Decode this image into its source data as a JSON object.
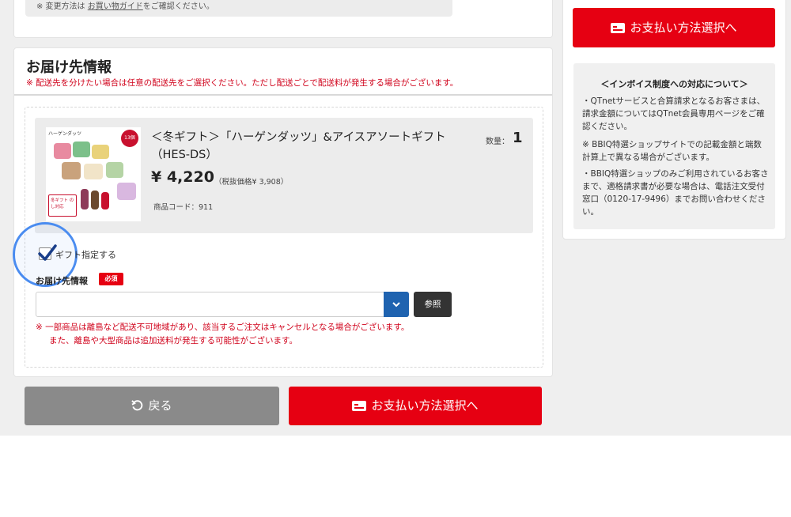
{
  "top_note": {
    "prefix": "※ 変更方法は",
    "link": "お買い物ガイド",
    "suffix": "をご確認ください。"
  },
  "delivery": {
    "title": "お届け先情報",
    "note": "※ 配送先を分けたい場合は任意の配送先をご選択ください。ただし配送ごとで配送料が発生する場合がございます。",
    "product": {
      "name": "＜冬ギフト＞「ハーゲンダッツ」&アイスアソートギフト（HES-DS）",
      "qty_label": "数量：",
      "qty": "1",
      "price": "¥ 4,220",
      "price_tax": "（税抜価格¥ 3,908）",
      "code": "商品コード：911",
      "image_brand": "ハーゲンダッツ",
      "image_badge": "13個",
      "image_tag": "冬ギフト のし対応"
    },
    "gift_label": "ギフト指定する",
    "gift_checked": true,
    "dest_label": "お届け先情報",
    "required_badge": "必須",
    "select_value": "",
    "ref_button": "参照",
    "warning_line1": "※ 一部商品は離島など配送不可地域があり、該当するご注文はキャンセルとなる場合がございます。",
    "warning_line2": "また、離島や大型商品は追加送料が発生する可能性がございます。"
  },
  "buttons": {
    "back": "戻る",
    "pay": "お支払い方法選択へ",
    "pay_top": "お支払い方法選択へ"
  },
  "invoice": {
    "title": "＜インボイス制度への対応について＞",
    "item1": "・QTnetサービスと合算請求となるお客さまは、請求金額についてはQTnet会員専用ページをご確認ください。",
    "item2": "※ BBIQ特選ショップサイトでの記載金額と端数計算上で異なる場合がございます。",
    "item3": "・BBIQ特選ショップのみご利用されているお客さまで、適格請求書が必要な場合は、電話注文受付窓口（0120-17-9496）までお問い合わせください。"
  },
  "colors": {
    "accent_red": "#e60012",
    "note_red": "#d0021b",
    "select_blue": "#1f63b0",
    "back_gray": "#8a8a8a"
  },
  "icons": [
    "card-icon",
    "undo-icon",
    "checkmark-icon",
    "chevron-down-icon"
  ]
}
